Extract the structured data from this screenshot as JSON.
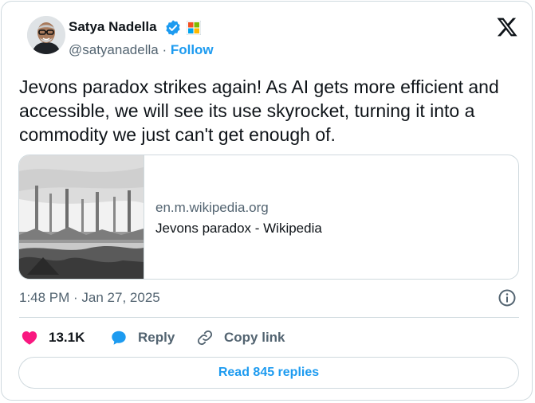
{
  "author": {
    "name": "Satya Nadella",
    "handle": "@satyanadella",
    "separator": " · ",
    "follow_label": "Follow",
    "verified_icon": "verified-badge-icon",
    "affiliate_icon": "microsoft-logo-icon"
  },
  "platform_icon": "x-logo-icon",
  "tweet": {
    "text": "Jevons paradox strikes again! As AI gets more efficient and accessible, we will see its use skyrocket, turning it into a commodity we just can't get enough of."
  },
  "link_card": {
    "domain": "en.m.wikipedia.org",
    "title": "Jevons paradox - Wikipedia",
    "thumbnail_icon": "industrial-engraving-image"
  },
  "timestamp": "1:48 PM · Jan 27, 2025",
  "actions": {
    "likes_count": "13.1K",
    "reply_label": "Reply",
    "copy_link_label": "Copy link"
  },
  "read_replies_label": "Read 845 replies",
  "colors": {
    "accent": "#1d9bf0",
    "like": "#f91880",
    "text": "#0f1419",
    "secondary_text": "#536471",
    "border": "#cfd9de"
  }
}
